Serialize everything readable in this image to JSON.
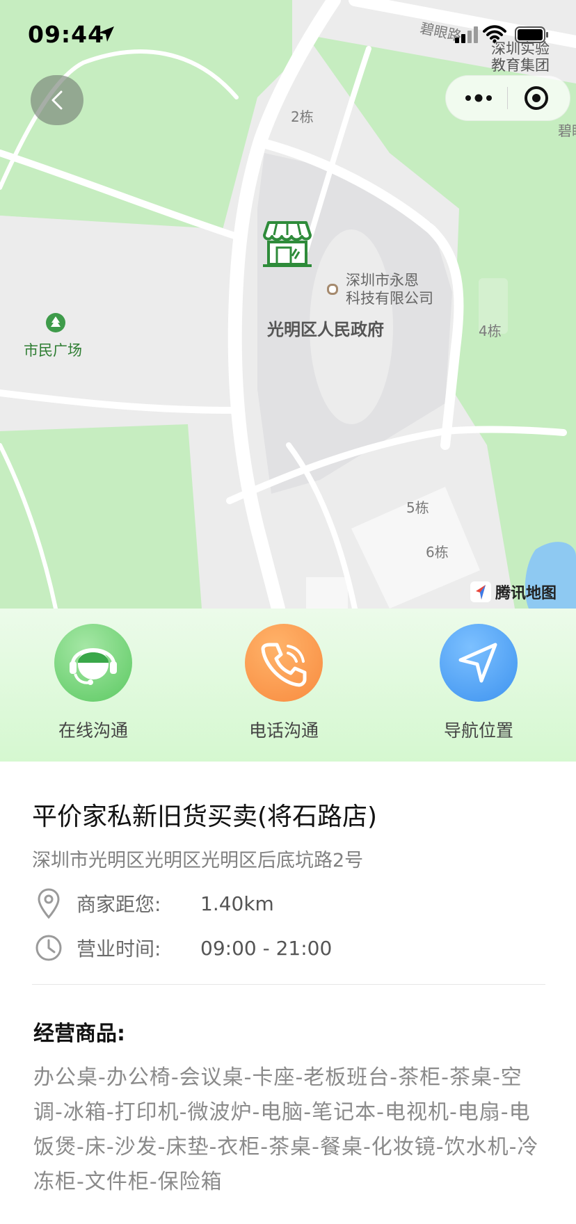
{
  "status_bar": {
    "time": "09:44"
  },
  "map": {
    "road_labels": {
      "top_road": "碧眼路",
      "right_road": "碧眼"
    },
    "corner_poi": [
      "深圳实验",
      "教育集团"
    ],
    "building_labels": {
      "b2": "2栋",
      "b4": "4栋",
      "b5": "5栋",
      "b6": "6栋"
    },
    "poi_company": [
      "深圳市永恩",
      "科技有限公司"
    ],
    "gov_label": "光明区人民政府",
    "park_label": "市民广场",
    "attribution": "腾讯地图",
    "colors": {
      "park": "#c6edc0",
      "ground": "#ececec",
      "plaza": "#e1e1e3",
      "road": "#ffffff",
      "water": "#8ec9f2"
    }
  },
  "actions": [
    {
      "label": "在线沟通",
      "icon": "customer-service-icon",
      "color": "#5cc962"
    },
    {
      "label": "电话沟通",
      "icon": "phone-icon",
      "color": "#f88b3f"
    },
    {
      "label": "导航位置",
      "icon": "navigation-icon",
      "color": "#3e93ef"
    }
  ],
  "store": {
    "name": "平价家私新旧货买卖(将石路店)",
    "address": "深圳市光明区光明区光明区后底坑路2号",
    "distance_label": "商家距您:",
    "distance_value": "1.40km",
    "hours_label": "营业时间:",
    "hours_value": "09:00 - 21:00",
    "goods_heading": "经营商品:",
    "goods_text": "办公桌-办公椅-会议桌-卡座-老板班台-茶柜-茶桌-空调-冰箱-打印机-微波炉-电脑-笔记本-电视机-电扇-电饭煲-床-沙发-床垫-衣柜-茶桌-餐桌-化妆镜-饮水机-冷冻柜-文件柜-保险箱"
  }
}
